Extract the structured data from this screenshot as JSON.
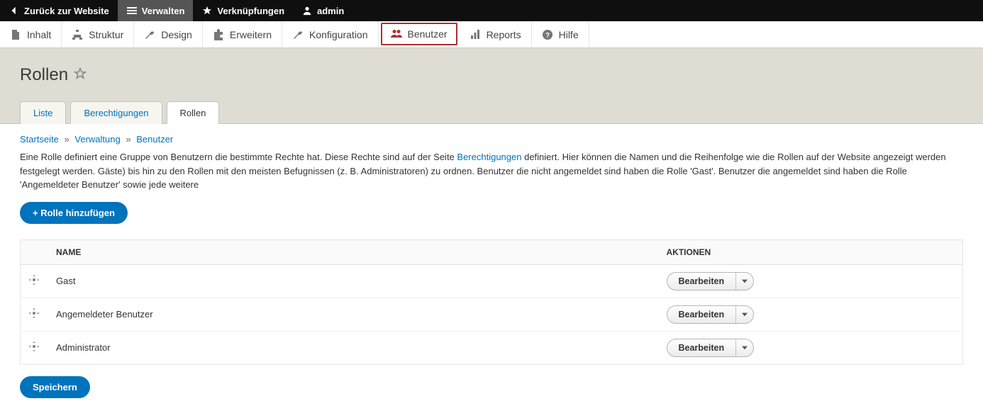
{
  "toolbar": {
    "back": "Zurück zur Website",
    "manage": "Verwalten",
    "shortcuts": "Verknüpfungen",
    "user": "admin"
  },
  "admin_menu": {
    "content": "Inhalt",
    "structure": "Struktur",
    "design": "Design",
    "extend": "Erweitern",
    "config": "Konfiguration",
    "users": "Benutzer",
    "reports": "Reports",
    "help": "Hilfe"
  },
  "page": {
    "title": "Rollen"
  },
  "tabs": {
    "list": "Liste",
    "permissions": "Berechtigungen",
    "roles": "Rollen"
  },
  "breadcrumb": {
    "home": "Startseite",
    "admin": "Verwaltung",
    "users": "Benutzer"
  },
  "description": {
    "part1": "Eine Rolle definiert eine Gruppe von Benutzern die bestimmte Rechte hat. Diese Rechte sind auf der Seite ",
    "link": "Berechtigungen",
    "part2": " definiert. Hier können die Namen und die Reihenfolge wie die Rollen auf der Website angezeigt werden festgelegt werden. Gäste) bis hin zu den Rollen mit den meisten Befugnissen (z. B. Administratoren) zu ordnen. Benutzer die nicht angemeldet sind haben die Rolle 'Gast'. Benutzer die angemeldet sind haben die Rolle 'Angemeldeter Benutzer' sowie jede weitere "
  },
  "buttons": {
    "add_role": "+ Rolle hinzufügen",
    "save": "Speichern",
    "edit": "Bearbeiten"
  },
  "table": {
    "col_name": "NAME",
    "col_actions": "AKTIONEN",
    "rows": [
      {
        "name": "Gast"
      },
      {
        "name": "Angemeldeter Benutzer"
      },
      {
        "name": "Administrator"
      }
    ]
  }
}
